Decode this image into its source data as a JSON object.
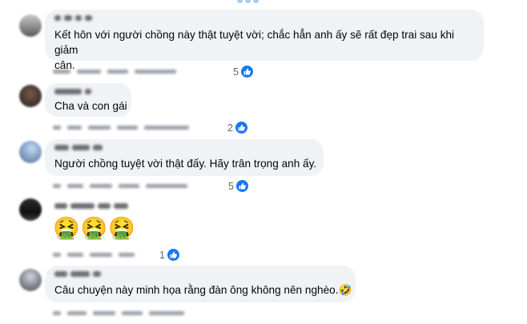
{
  "comments": [
    {
      "text_line1": "Kết hôn với người chồng này thật tuyệt vời; chắc hẳn anh ấy sẽ rất đẹp trai sau khi giảm",
      "text_line2": "cân.",
      "likes": "5"
    },
    {
      "text_line1": "Cha và con gái",
      "likes": "2"
    },
    {
      "text_line1": "Người chồng tuyệt vời thật đấy. Hãy trân trọng anh ấy.",
      "likes": "5"
    },
    {
      "emojis": "🤮🤮🤮",
      "likes": "1"
    },
    {
      "text_line1": "Câu chuyện này minh họa rằng đàn ông không nên nghèo.🤣"
    }
  ],
  "icons": {
    "like": "like-icon",
    "avatar": "avatar"
  },
  "colors": {
    "bubble": "#f0f2f5",
    "like": "#1877f2",
    "meta": "#65676b"
  }
}
